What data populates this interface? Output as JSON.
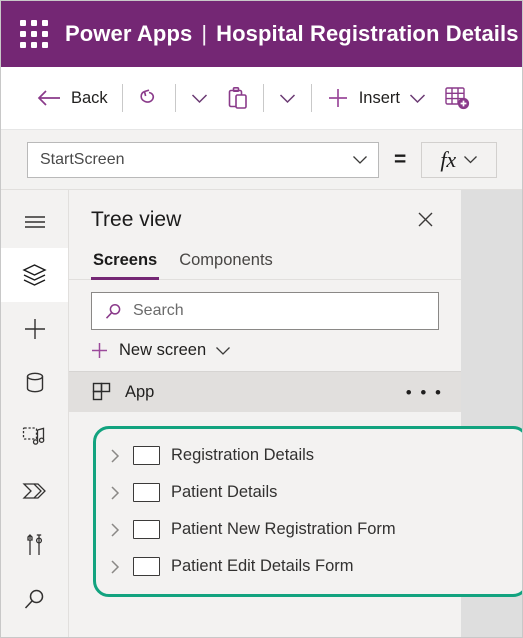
{
  "topbar": {
    "waffle_icon": "app-launcher-waffle-icon",
    "product": "Power Apps",
    "separator": "|",
    "app_title": "Hospital Registration Details",
    "bg_color": "#742774"
  },
  "toolbar": {
    "back_label": "Back",
    "back_icon": "arrow-left-icon",
    "undo_icon": "undo-icon",
    "undo_caret_icon": "chevron-down-icon",
    "paste_icon": "clipboard-paste-icon",
    "paste_caret_icon": "chevron-down-icon",
    "insert_icon": "plus-icon",
    "insert_label": "Insert",
    "insert_caret_icon": "chevron-down-icon",
    "new_data_icon": "add-data-table-icon",
    "accent_color": "#8a3a8a"
  },
  "formula_bar": {
    "property_value": "StartScreen",
    "property_caret_icon": "chevron-down-icon",
    "equals": "=",
    "fx_label": "fx",
    "fx_caret_icon": "chevron-down-icon"
  },
  "rail": {
    "items": [
      {
        "name": "menu-hamburger",
        "icon": "hamburger-menu-icon",
        "active": false
      },
      {
        "name": "tree-view",
        "icon": "layers-tree-view-icon",
        "active": true
      },
      {
        "name": "insert",
        "icon": "plus-icon",
        "active": false
      },
      {
        "name": "data",
        "icon": "database-cylinder-icon",
        "active": false
      },
      {
        "name": "media",
        "icon": "media-image-music-icon",
        "active": false
      },
      {
        "name": "power-automate",
        "icon": "power-automate-flow-icon",
        "active": false
      },
      {
        "name": "settings-tools",
        "icon": "tools-screwdriver-wrench-icon",
        "active": false
      },
      {
        "name": "search",
        "icon": "search-magnifier-icon",
        "active": false
      }
    ]
  },
  "tree_panel": {
    "title": "Tree view",
    "close_icon": "close-x-icon",
    "tabs": [
      {
        "label": "Screens",
        "active": true
      },
      {
        "label": "Components",
        "active": false
      }
    ],
    "search": {
      "placeholder": "Search",
      "value": "",
      "icon": "search-magnifier-icon"
    },
    "new_screen": {
      "label": "New screen",
      "icon": "plus-icon",
      "caret_icon": "chevron-down-icon"
    },
    "app_row": {
      "label": "App",
      "icon": "app-grid-icon",
      "overflow_icon": "more-ellipsis-icon",
      "overflow_label": "• • •"
    },
    "highlight_color": "#12a37f",
    "screens": [
      {
        "label": "Registration Details",
        "expand_icon": "chevron-right-icon",
        "thumb_icon": "screen-thumbnail-icon"
      },
      {
        "label": "Patient Details",
        "expand_icon": "chevron-right-icon",
        "thumb_icon": "screen-thumbnail-icon"
      },
      {
        "label": "Patient New Registration Form",
        "expand_icon": "chevron-right-icon",
        "thumb_icon": "screen-thumbnail-icon"
      },
      {
        "label": "Patient Edit Details Form",
        "expand_icon": "chevron-right-icon",
        "thumb_icon": "screen-thumbnail-icon"
      }
    ]
  }
}
